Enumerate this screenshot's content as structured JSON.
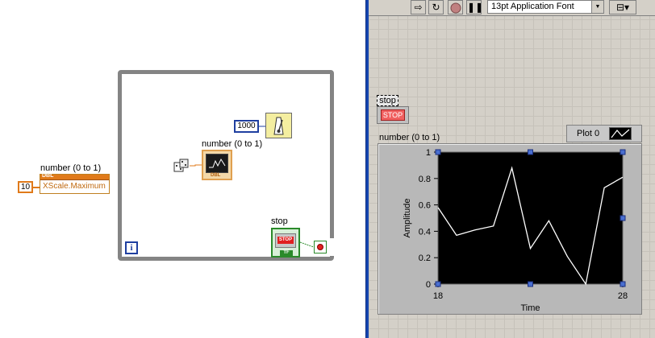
{
  "block_diagram": {
    "property_node": {
      "label": "number (0 to 1)",
      "tag": "DBL",
      "property": "XScale.Maximum"
    },
    "const_ten": "10",
    "const_wait": "1000",
    "indicator_label": "number (0 to 1)",
    "indicator_tag": "DBL",
    "stop_label": "stop",
    "stop_btn_text": "STOP",
    "tf_text": "TF",
    "iteration": "i"
  },
  "toolbar": {
    "font": "13pt Application Font",
    "run_icon": "run-arrow-icon",
    "run_continuous_icon": "run-continuously-icon",
    "abort_icon": "abort-icon",
    "pause_icon": "pause-icon",
    "align_icon": "align-icon"
  },
  "front_panel": {
    "stop_label": "stop",
    "stop_button": "STOP",
    "graph_label": "number (0 to 1)",
    "legend_name": "Plot 0"
  },
  "chart_data": {
    "type": "line",
    "title": "",
    "xlabel": "Time",
    "ylabel": "Amplitude",
    "xlim": [
      18,
      28
    ],
    "ylim": [
      0,
      1
    ],
    "x_ticks": [
      "18",
      "28"
    ],
    "y_ticks": [
      "0",
      "0.2",
      "0.4",
      "0.6",
      "0.8",
      "1"
    ],
    "background": "#000000",
    "line_color": "#ffffff",
    "series": [
      {
        "name": "Plot 0",
        "x": [
          18,
          19,
          20,
          21,
          22,
          23,
          24,
          25,
          26,
          27,
          28
        ],
        "y": [
          0.58,
          0.37,
          0.41,
          0.44,
          0.88,
          0.27,
          0.48,
          0.21,
          0.0,
          0.73,
          0.81
        ]
      }
    ]
  }
}
